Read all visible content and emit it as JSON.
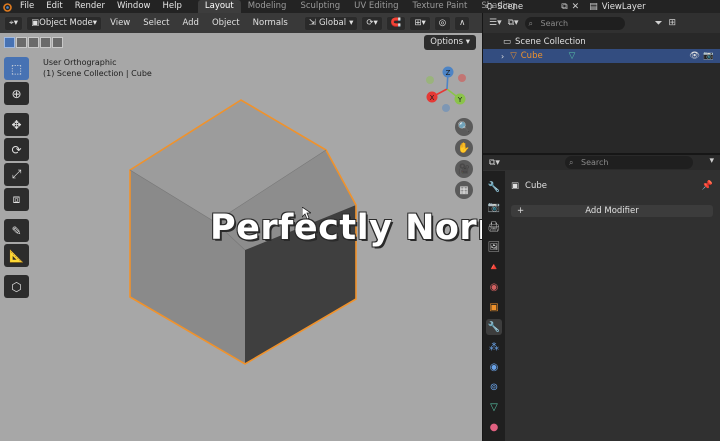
{
  "menubar": {
    "menus": [
      "File",
      "Edit",
      "Render",
      "Window",
      "Help"
    ],
    "workspaces": [
      {
        "label": "Layout",
        "active": true
      },
      {
        "label": "Modeling",
        "active": false
      },
      {
        "label": "Sculpting",
        "active": false
      },
      {
        "label": "UV Editing",
        "active": false
      },
      {
        "label": "Texture Paint",
        "active": false
      },
      {
        "label": "Shading",
        "active": false
      }
    ],
    "scene": "Scene",
    "view_layer": "ViewLayer"
  },
  "viewport": {
    "mode": "Object Mode",
    "header_menus": [
      "View",
      "Select",
      "Add",
      "Object",
      "Normals"
    ],
    "transform_orientation": "Global",
    "options_label": "Options",
    "view_name": "User Orthographic",
    "collection_info": "(1) Scene Collection | Cube",
    "gizmo_labels": {
      "x": "X",
      "y": "Y",
      "z": "Z"
    },
    "caption": "Perfectly Normal"
  },
  "outliner": {
    "search_placeholder": "Search",
    "collection": "Scene Collection",
    "object": "Cube"
  },
  "properties": {
    "search_placeholder": "Search",
    "object_name": "Cube",
    "add_modifier_label": "Add Modifier"
  },
  "colors": {
    "accent": "#4772b3",
    "selection_outline": "#f0922b",
    "viewport_bg": "#a7a7a7"
  }
}
